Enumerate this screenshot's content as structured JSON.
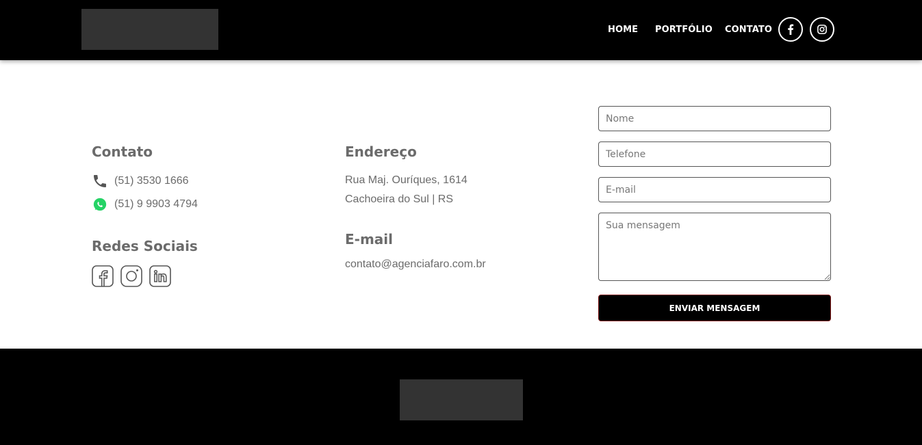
{
  "header": {
    "nav": [
      {
        "label": "HOME"
      },
      {
        "label": "PORTFÓLIO"
      },
      {
        "label": "CONTATO"
      }
    ],
    "social": [
      "facebook-icon",
      "instagram-icon"
    ]
  },
  "contact": {
    "title": "Contato",
    "phone": "(51) 3530 1666",
    "whatsapp": "(51) 9 9903 4794",
    "social_title": "Redes Sociais",
    "social_icons": [
      "facebook-icon",
      "instagram-icon",
      "linkedin-icon"
    ]
  },
  "address": {
    "title": "Endereço",
    "line1": "Rua Maj. Ouríques, 1614",
    "line2": "Cachoeira do Sul | RS",
    "email_title": "E-mail",
    "email": "contato@agenciafaro.com.br"
  },
  "form": {
    "name_placeholder": "Nome",
    "phone_placeholder": "Telefone",
    "email_placeholder": "E-mail",
    "message_placeholder": "Sua mensagem",
    "submit_label": "ENVIAR MENSAGEM"
  },
  "colors": {
    "header_bg": "#000000",
    "logo_placeholder": "#333333",
    "text_gray": "#6b6b6b",
    "whatsapp_green": "#25d366",
    "button_border": "#7a1010"
  }
}
